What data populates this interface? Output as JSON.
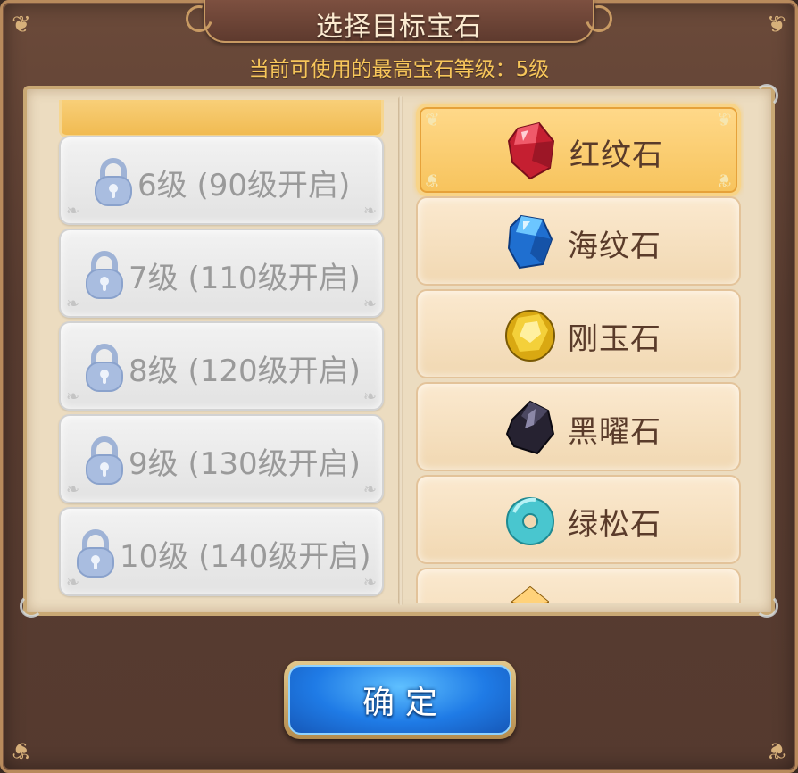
{
  "dialog": {
    "title": "选择目标宝石",
    "subtitle": "当前可使用的最高宝石等级：5级"
  },
  "level_list": {
    "items": [
      {
        "label": "6级 (90级开启)",
        "locked": true
      },
      {
        "label": "7级 (110级开启)",
        "locked": true
      },
      {
        "label": "8级 (120级开启)",
        "locked": true
      },
      {
        "label": "9级 (130级开启)",
        "locked": true
      },
      {
        "label": "10级 (140级开启)",
        "locked": true
      }
    ]
  },
  "gem_list": {
    "items": [
      {
        "label": "红纹石",
        "icon": "red-gem-icon",
        "color": "#d8283a",
        "selected": true
      },
      {
        "label": "海纹石",
        "icon": "blue-gem-icon",
        "color": "#2a86e0",
        "selected": false
      },
      {
        "label": "刚玉石",
        "icon": "yellow-gem-icon",
        "color": "#e0b418",
        "selected": false
      },
      {
        "label": "黑曜石",
        "icon": "black-gem-icon",
        "color": "#2b2735",
        "selected": false
      },
      {
        "label": "绿松石",
        "icon": "turquoise-ring-icon",
        "color": "#49c6cf",
        "selected": false
      },
      {
        "label": "",
        "icon": "orange-gem-icon",
        "color": "#f0a020",
        "selected": false
      }
    ]
  },
  "confirm_button": {
    "label": "确定",
    "color": "#1f7be6"
  }
}
